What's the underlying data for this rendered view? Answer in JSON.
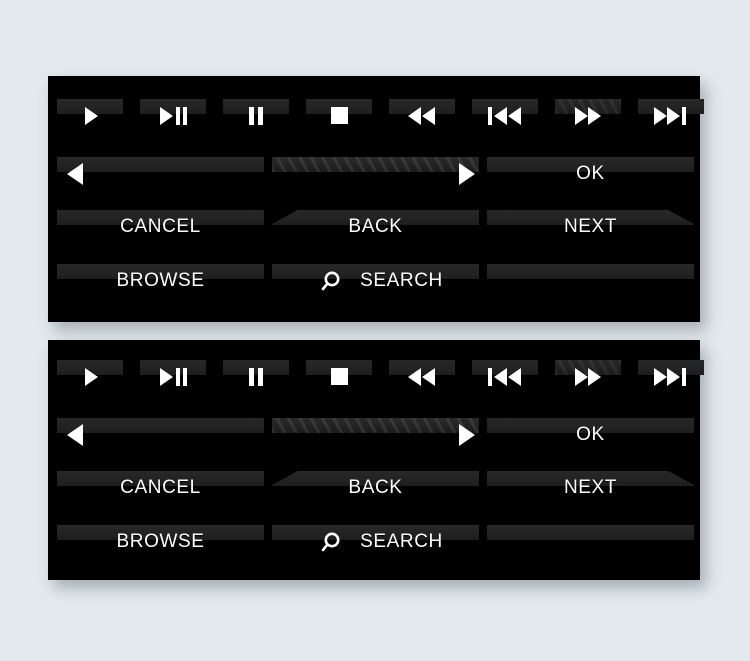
{
  "background_color": "#e3e9ec",
  "panel_color": "#000000",
  "button_bar_color": "#242424",
  "glyph_color": "#ffffff",
  "panels": [
    {
      "name": "control-panel-top"
    },
    {
      "name": "control-panel-bottom"
    }
  ],
  "transport_row": {
    "buttons": [
      {
        "name": "play-button",
        "icon": "play-icon",
        "label": ""
      },
      {
        "name": "play-pause-button",
        "icon": "play-pause-icon",
        "label": ""
      },
      {
        "name": "pause-button",
        "icon": "pause-icon",
        "label": ""
      },
      {
        "name": "stop-button",
        "icon": "stop-icon",
        "label": ""
      },
      {
        "name": "rewind-button",
        "icon": "rewind-icon",
        "label": ""
      },
      {
        "name": "previous-track-button",
        "icon": "previous-icon",
        "label": ""
      },
      {
        "name": "fast-forward-button",
        "icon": "fast-forward-icon",
        "label": ""
      },
      {
        "name": "next-track-button",
        "icon": "next-icon",
        "label": ""
      }
    ]
  },
  "nav_row": {
    "buttons": [
      {
        "name": "previous-arrow-button",
        "icon": "arrow-left-icon",
        "label": ""
      },
      {
        "name": "next-arrow-button",
        "icon": "arrow-right-icon",
        "label": ""
      },
      {
        "name": "ok-button",
        "icon": "",
        "label": "OK"
      }
    ]
  },
  "action_row": {
    "buttons": [
      {
        "name": "cancel-button",
        "icon": "",
        "label": "CANCEL"
      },
      {
        "name": "back-button",
        "icon": "",
        "label": "BACK"
      },
      {
        "name": "next-button",
        "icon": "",
        "label": "NEXT"
      }
    ]
  },
  "utility_row": {
    "buttons": [
      {
        "name": "browse-button",
        "icon": "",
        "label": "BROWSE"
      },
      {
        "name": "search-button",
        "icon": "search-icon",
        "label": "SEARCH"
      },
      {
        "name": "blank-button",
        "icon": "",
        "label": ""
      }
    ]
  }
}
